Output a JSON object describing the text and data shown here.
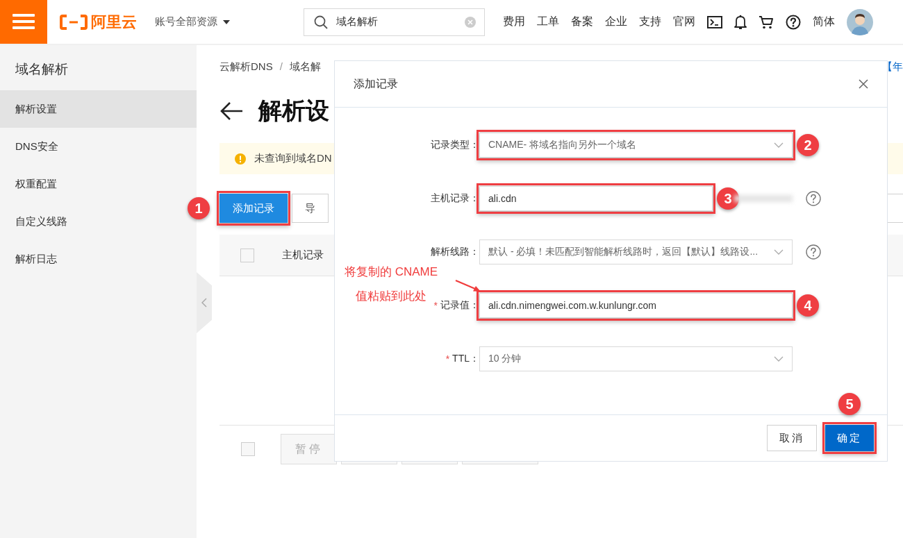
{
  "topbar": {
    "logo_text": "阿里云",
    "account_menu": "账号全部资源",
    "search": {
      "value": "域名解析"
    },
    "nav": [
      "费用",
      "工单",
      "备案",
      "企业",
      "支持",
      "官网"
    ],
    "language": "简体"
  },
  "sidebar": {
    "title": "域名解析",
    "items": [
      {
        "label": "解析设置",
        "selected": true
      },
      {
        "label": "DNS安全",
        "selected": false
      },
      {
        "label": "权重配置",
        "selected": false
      },
      {
        "label": "自定义线路",
        "selected": false
      },
      {
        "label": "解析日志",
        "selected": false
      }
    ]
  },
  "main": {
    "breadcrumb": [
      "云解析DNS",
      "域名解"
    ],
    "separator": "/",
    "promo_link": "【年",
    "title": "解析设",
    "alert": "未查询到域名DN",
    "toolbar": [
      {
        "label": "添加记录",
        "kind": "primary",
        "highlighted": true,
        "badge": "1"
      },
      {
        "label": "导",
        "kind": "default",
        "highlighted": false
      }
    ],
    "table": {
      "checked": false,
      "columns": [
        "主机记录"
      ]
    },
    "batch_checked": false,
    "batch_buttons": [
      {
        "kind": "text",
        "label": "暂停"
      },
      {
        "kind": "blank"
      },
      {
        "kind": "blank"
      },
      {
        "kind": "blank"
      }
    ]
  },
  "dialog": {
    "title": "添加记录",
    "fields": [
      {
        "label": "记录类型：",
        "kind": "select",
        "value": "CNAME- 将域名指向另外一个域名",
        "help": false,
        "highlighted": true,
        "badge": "2"
      },
      {
        "label": "主机记录：",
        "kind": "input",
        "value": "ali.cdn",
        "blurred_suffix": true,
        "help": true,
        "highlighted": true,
        "badge": "3"
      },
      {
        "label": "解析线路：",
        "kind": "select",
        "value": "默认 - 必填！未匹配到智能解析线路时，返回【默认】线路设...",
        "help": true,
        "highlighted": false
      },
      {
        "label": "记录值：",
        "mark": "*",
        "kind": "input",
        "value": "ali.cdn.nimengwei.com.w.kunlungr.com",
        "help": false,
        "highlighted": true,
        "badge": "4"
      },
      {
        "label": "TTL：",
        "mark": "*",
        "kind": "select",
        "value": "10 分钟",
        "help": false,
        "highlighted": false
      }
    ],
    "buttons": [
      {
        "label": "取消",
        "kind": "default",
        "highlighted": false
      },
      {
        "label": "确定",
        "kind": "primary",
        "highlighted": true,
        "badge": "5"
      }
    ],
    "note": [
      "将复制的 CNAME",
      "值粘贴到此处"
    ]
  }
}
